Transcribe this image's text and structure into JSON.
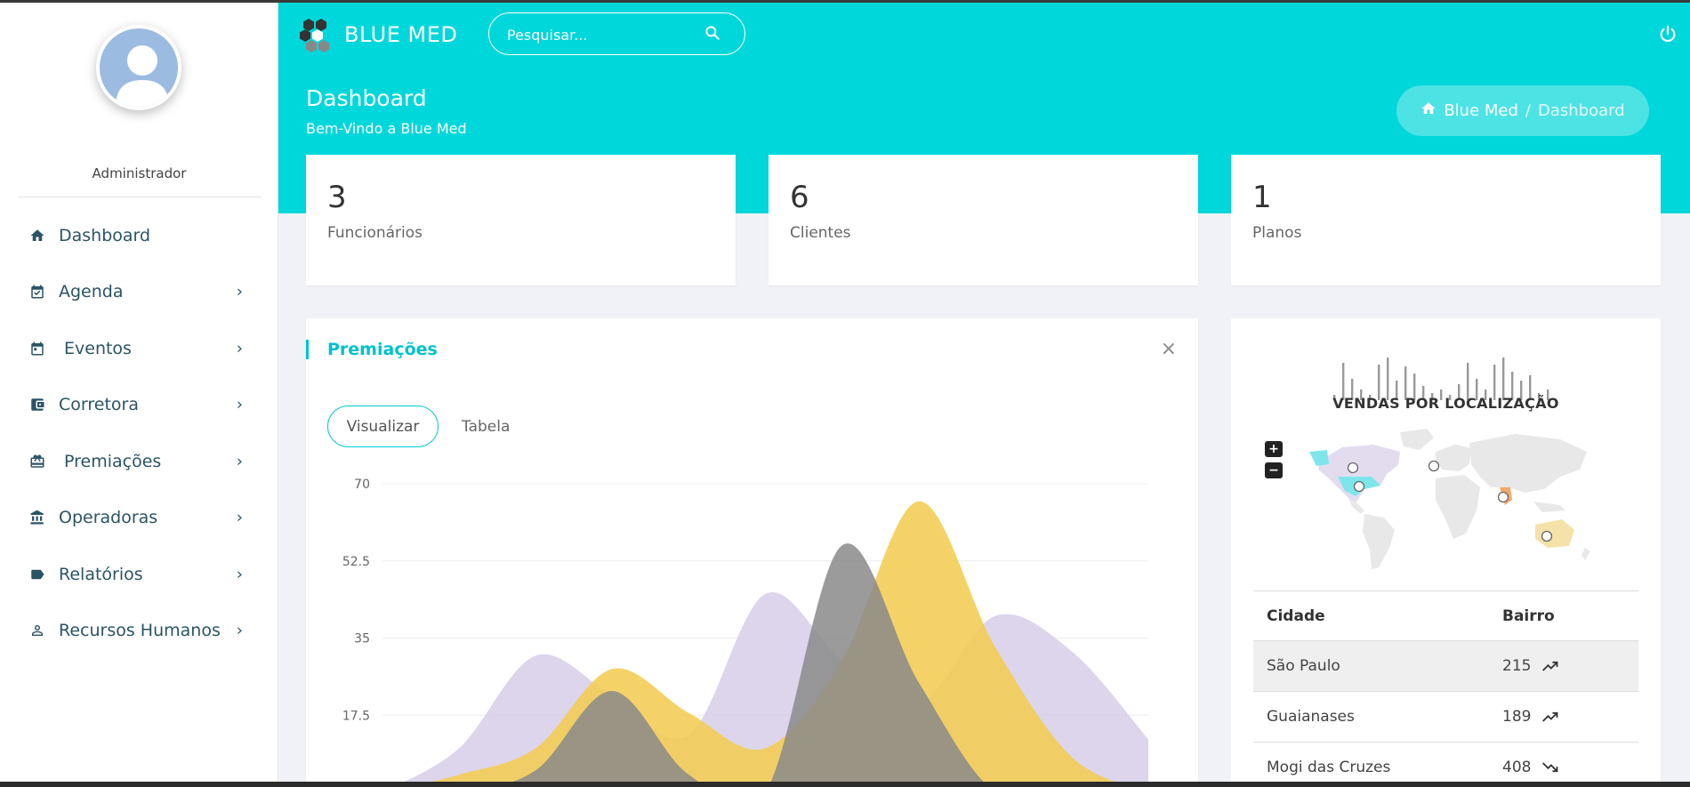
{
  "app": {
    "brand": "BLUE MED"
  },
  "search": {
    "placeholder": "Pesquisar..."
  },
  "sidebar": {
    "role": "Administrador",
    "items": [
      {
        "label": "Dashboard",
        "icon": "home-icon",
        "has_children": false
      },
      {
        "label": "Agenda",
        "icon": "calendar-check-icon",
        "has_children": true
      },
      {
        "label": "Eventos",
        "icon": "calendar-icon",
        "has_children": true
      },
      {
        "label": "Corretora",
        "icon": "wallet-icon",
        "has_children": true
      },
      {
        "label": "Premiações",
        "icon": "gift-icon",
        "has_children": true
      },
      {
        "label": "Operadoras",
        "icon": "bank-icon",
        "has_children": true
      },
      {
        "label": "Relatórios",
        "icon": "label-icon",
        "has_children": true
      },
      {
        "label": "Recursos Humanos",
        "icon": "person-icon",
        "has_children": true
      }
    ]
  },
  "page": {
    "title": "Dashboard",
    "subtitle": "Bem-Vindo a Blue Med",
    "breadcrumb": {
      "home": "Blue Med",
      "current": "Dashboard",
      "separator": "/"
    }
  },
  "stats": [
    {
      "value": "3",
      "label": "Funcionários"
    },
    {
      "value": "6",
      "label": "Clientes"
    },
    {
      "value": "1",
      "label": "Planos"
    }
  ],
  "premiacoes": {
    "title": "Premiações",
    "close": "×",
    "tabs": {
      "active": "Visualizar",
      "other": "Tabela"
    }
  },
  "chart_data": {
    "type": "area",
    "ylim": [
      0,
      70
    ],
    "y_ticks": [
      "70",
      "52.5",
      "35",
      "17.5"
    ],
    "grid": true,
    "x": [
      0,
      1,
      2,
      3,
      4,
      5,
      6,
      7,
      8,
      9,
      10
    ],
    "series": [
      {
        "color": "#d8d0ea",
        "values": [
          0,
          10,
          31,
          22,
          13,
          45,
          30,
          20,
          40,
          32,
          12
        ]
      },
      {
        "color": "#f3cd57",
        "values": [
          0,
          4,
          10,
          28,
          18,
          10,
          30,
          66,
          33,
          8,
          0
        ]
      },
      {
        "color": "#8a8a8a",
        "values": [
          0,
          0,
          5,
          23,
          4,
          0,
          56,
          25,
          0,
          0,
          0
        ]
      }
    ]
  },
  "map": {
    "title": "VENDAS POR LOCALIZAÇÃO",
    "zoom_in": "+",
    "zoom_out": "−",
    "columns": [
      "Cidade",
      "Bairro"
    ],
    "rows": [
      {
        "city": "São Paulo",
        "value": "215",
        "trend": "up"
      },
      {
        "city": "Guaianases",
        "value": "189",
        "trend": "up"
      },
      {
        "city": "Mogi das Cruzes",
        "value": "408",
        "trend": "down"
      }
    ]
  },
  "colors": {
    "primary": "#00d7da",
    "accent": "#00c2cc",
    "nav_text": "#2b5465"
  }
}
